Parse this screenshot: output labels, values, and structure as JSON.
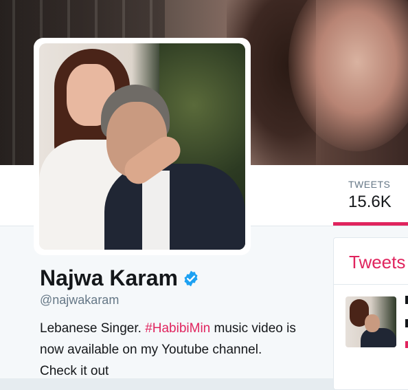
{
  "profile": {
    "name": "Najwa Karam",
    "handle": "@najwakaram",
    "bio_before": "Lebanese Singer. ",
    "bio_hashtag": "#HabibiMin",
    "bio_after": " music video is now available on my Youtube channel. Check it out"
  },
  "nav": {
    "tweets_label": "TWEETS",
    "tweets_count": "15.6K"
  },
  "timeline": {
    "title": "Tweets"
  },
  "icons": {
    "verified": "verified-badge-icon"
  },
  "colors": {
    "accent": "#e0245e",
    "verified": "#1da1f2",
    "text": "#14171a",
    "muted": "#657786"
  }
}
